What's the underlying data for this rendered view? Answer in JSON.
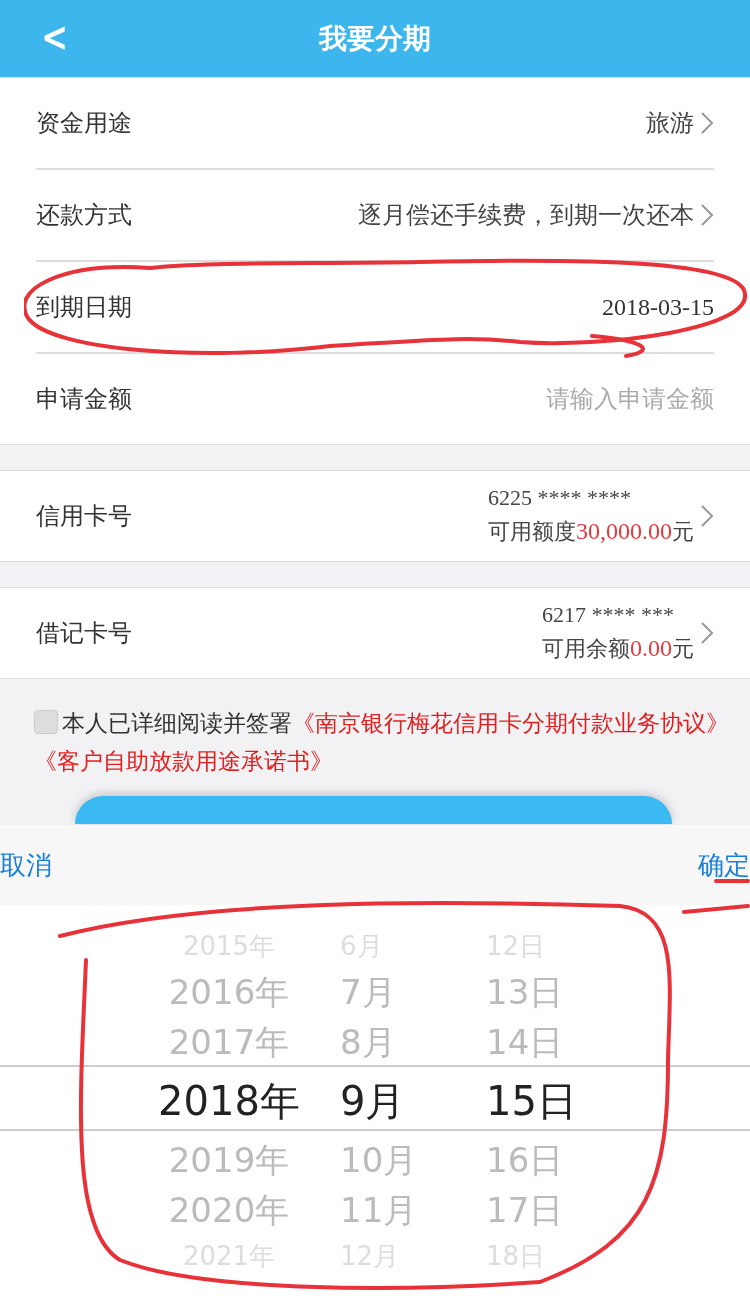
{
  "header": {
    "back": "<",
    "title": "我要分期"
  },
  "form_rows": [
    {
      "label": "资金用途",
      "value": "旅游",
      "kind": "select"
    },
    {
      "label": "还款方式",
      "value": "逐月偿还手续费，到期一次还本",
      "kind": "select"
    },
    {
      "label": "到期日期",
      "value": "2018-03-15",
      "kind": "date"
    },
    {
      "label": "申请金额",
      "placeholder": "请输入申请金额",
      "kind": "input"
    }
  ],
  "cards": [
    {
      "label": "信用卡号",
      "number": "6225 **** ****",
      "balance_label": "可用额度",
      "amount": "30,000.00",
      "unit": "元"
    },
    {
      "label": "借记卡号",
      "number": "6217 **** ***",
      "balance_label": "可用余额",
      "amount": "0.00",
      "unit": "元"
    }
  ],
  "agreement": {
    "checked": false,
    "text": "本人已详细阅读并签署",
    "links": [
      "《南京银行梅花信用卡分期付款业务协议》",
      "《客户自助放款用途承诺书》"
    ]
  },
  "picker": {
    "cancel": "取消",
    "confirm": "确定",
    "columns": [
      [
        {
          "text": "2015年",
          "selected": false
        },
        {
          "text": "2016年",
          "selected": false
        },
        {
          "text": "2017年",
          "selected": false
        },
        {
          "text": "2018年",
          "selected": true
        },
        {
          "text": "2019年",
          "selected": false
        },
        {
          "text": "2020年",
          "selected": false
        },
        {
          "text": "2021年",
          "selected": false
        }
      ],
      [
        {
          "text": "6月",
          "selected": false
        },
        {
          "text": "7月",
          "selected": false
        },
        {
          "text": "8月",
          "selected": false
        },
        {
          "text": "9月",
          "selected": true
        },
        {
          "text": "10月",
          "selected": false
        },
        {
          "text": "11月",
          "selected": false
        },
        {
          "text": "12月",
          "selected": false
        }
      ],
      [
        {
          "text": "12日",
          "selected": false
        },
        {
          "text": "13日",
          "selected": false
        },
        {
          "text": "14日",
          "selected": false
        },
        {
          "text": "15日",
          "selected": true
        },
        {
          "text": "16日",
          "selected": false
        },
        {
          "text": "17日",
          "selected": false
        },
        {
          "text": "18日",
          "selected": false
        }
      ]
    ]
  }
}
